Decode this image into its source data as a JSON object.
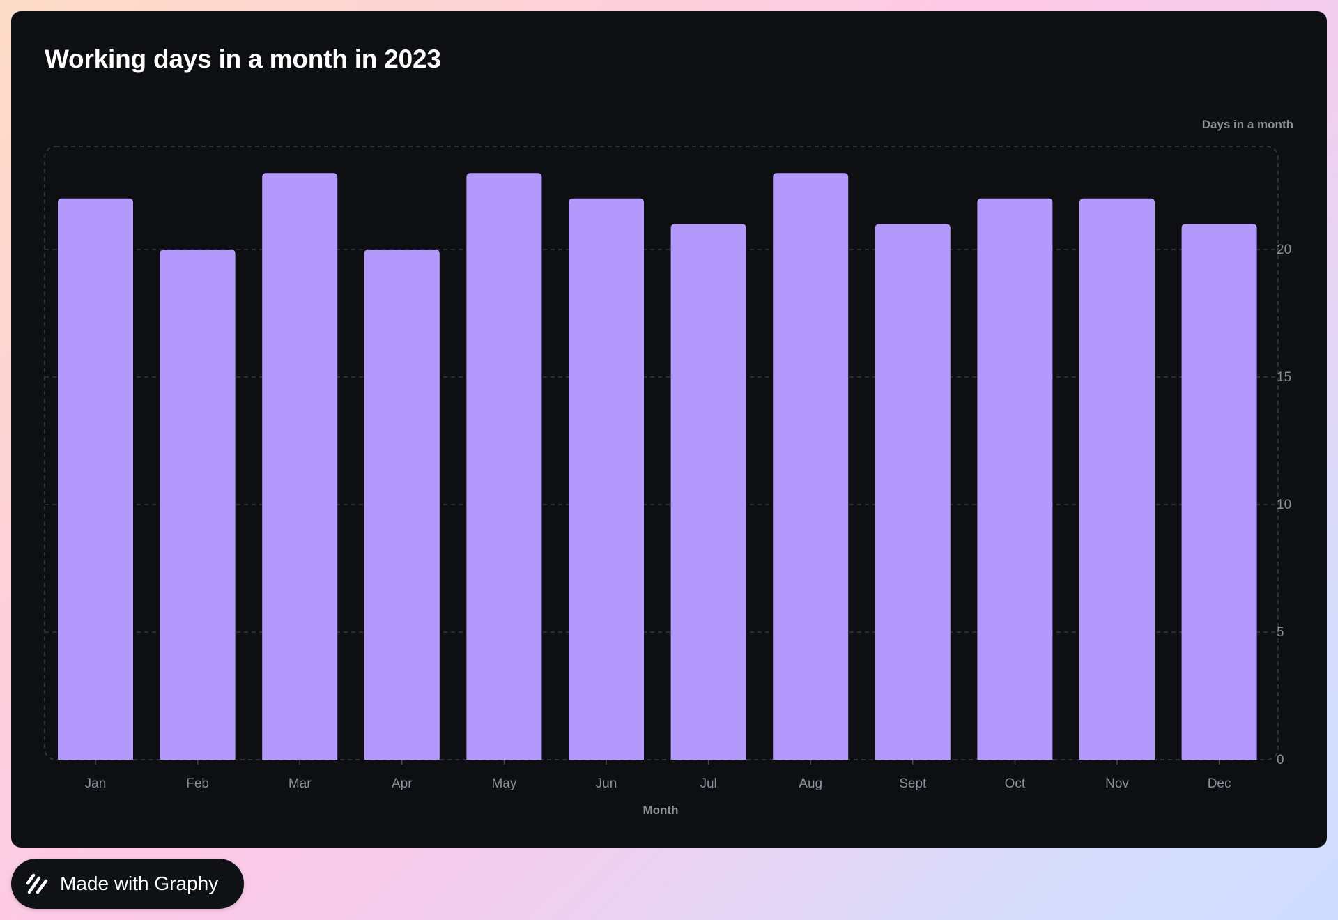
{
  "chart_data": {
    "type": "bar",
    "title": "Working days in a month in 2023",
    "xlabel": "Month",
    "ylabel": "Days in a month",
    "categories": [
      "Jan",
      "Feb",
      "Mar",
      "Apr",
      "May",
      "Jun",
      "Jul",
      "Aug",
      "Sept",
      "Oct",
      "Nov",
      "Dec"
    ],
    "values": [
      22,
      20,
      23,
      20,
      23,
      22,
      21,
      23,
      21,
      22,
      22,
      21
    ],
    "ylim": [
      0,
      24
    ],
    "yticks": [
      0,
      5,
      10,
      15,
      20
    ],
    "y_axis_side": "right",
    "grid": true,
    "bar_color": "#b399fc"
  },
  "badge": {
    "label": "Made with Graphy",
    "icon": "graphy-logo-icon"
  }
}
